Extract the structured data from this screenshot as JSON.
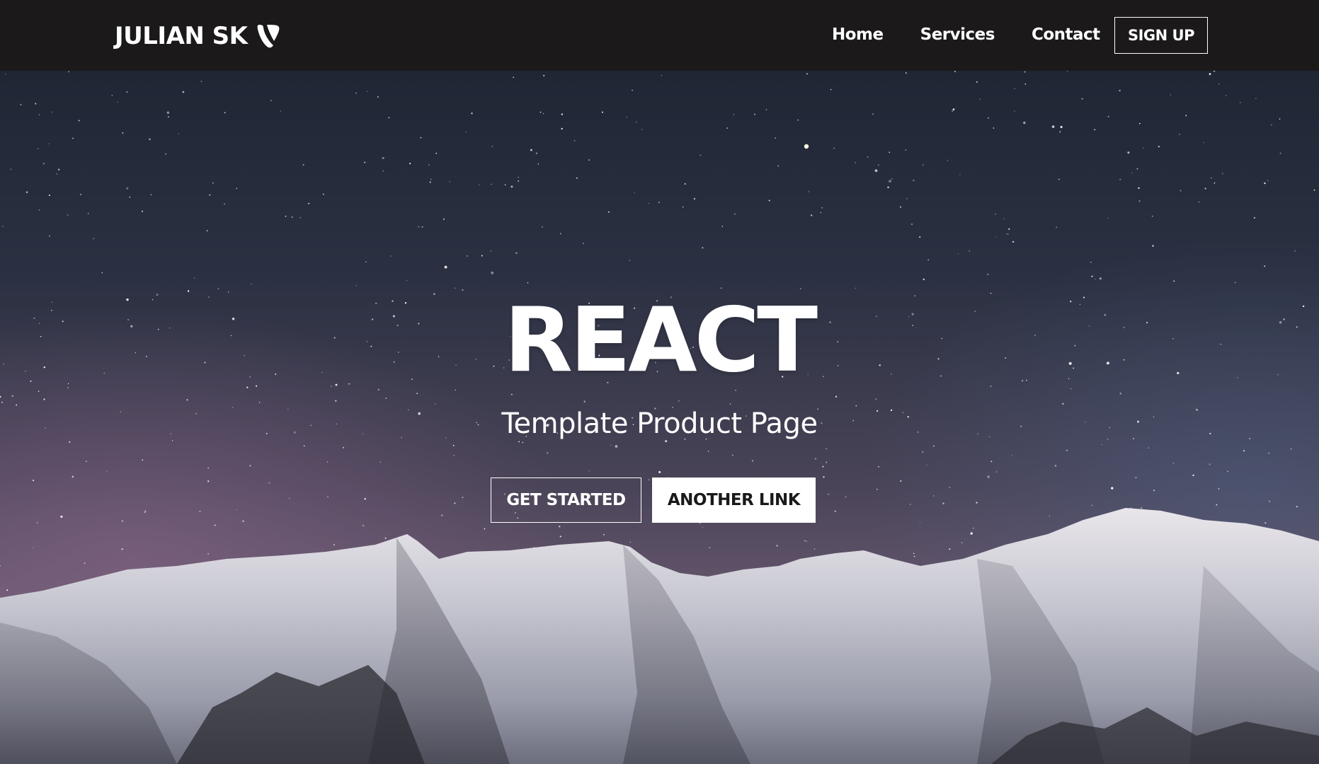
{
  "navbar": {
    "brand": "JULIAN SK",
    "links": [
      {
        "label": "Home"
      },
      {
        "label": "Services"
      },
      {
        "label": "Contact"
      }
    ],
    "signup_label": "SIGN UP"
  },
  "hero": {
    "title": "REACT",
    "subtitle": "Template Product Page",
    "primary_button": "GET STARTED",
    "secondary_button": "ANOTHER LINK"
  },
  "colors": {
    "navbar_bg": "#1b191a",
    "text": "#ffffff",
    "solid_button_bg": "#ffffff"
  },
  "icons": {
    "brand_logo": "typo3-logo-icon"
  }
}
